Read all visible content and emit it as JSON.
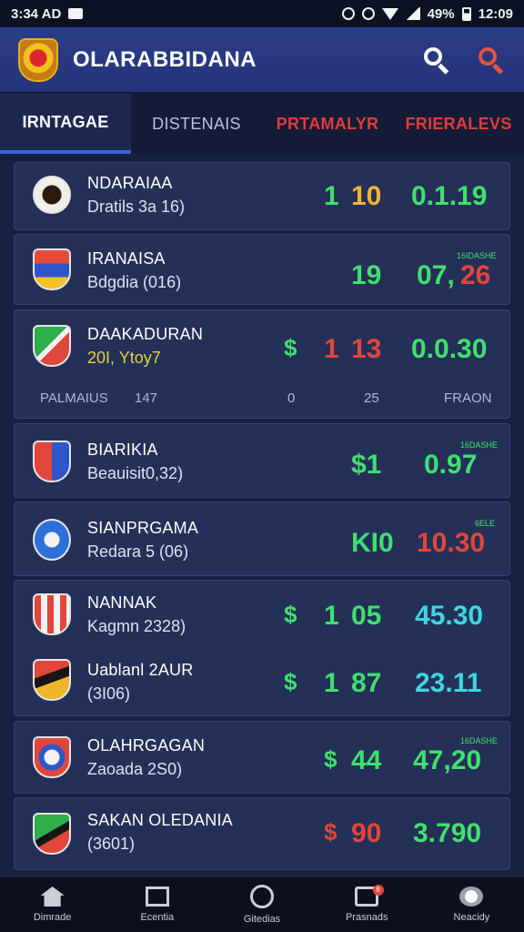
{
  "status_bar": {
    "time_left": "3:34 AD",
    "battery": "49%",
    "time_right": "12:09"
  },
  "header": {
    "title": "OLARABBIDANA"
  },
  "tabs": [
    {
      "label": "IRNTAGAE"
    },
    {
      "label": "DISTENAIS"
    },
    {
      "label": "PRTAMALYR"
    },
    {
      "label": "FRIERALEVS"
    }
  ],
  "rows": [
    {
      "name": "NDARAIAA",
      "sub": "Dratils 3a 16)",
      "v1": "1",
      "v2": "10",
      "v3": "0.1.19"
    },
    {
      "name": "IRANAISA",
      "sub": "Bdgdia (016)",
      "v2": "19",
      "v3": "07,",
      "v3b": "26",
      "tiny": "16IDASHE"
    },
    {
      "name": "DAAKADURAN",
      "sub": "20I, Ytoy7",
      "sym": "$",
      "v1": "1",
      "v2": "13",
      "v3": "0.0.30",
      "stats": {
        "label": "PALMAIUS",
        "a": "147",
        "b": "0",
        "c": "25",
        "d": "FRAON"
      }
    },
    {
      "name": "BIARIKIA",
      "sub": "Beauisit0,32)",
      "v2": "$1",
      "v3": "0.97",
      "tiny": "16DASHE"
    },
    {
      "name": "SIANPRGAMA",
      "sub": "Redara 5 (06)",
      "v2": "KI0",
      "v3": "10.30",
      "tiny": "6ELE"
    },
    {
      "name": "NANNAK",
      "sub": "Kagmn 2328)",
      "sym": "$",
      "v1": "1",
      "v2": "05",
      "v3": "45.30"
    },
    {
      "name": "Uablanl 2AUR",
      "sub": "(3I06)",
      "sym": "$",
      "v1": "1",
      "v2": "87",
      "v3": "23.11"
    },
    {
      "name": "OLAHRGAGAN",
      "sub": "Zaoada 2S0)",
      "sym": "$",
      "v2": "44",
      "v3": "47,20",
      "tiny": "16DASHE"
    },
    {
      "name": "SAKAN OLEDANIA",
      "sub": "(3601)",
      "sym": "$",
      "v2": "90",
      "v3": "3.790"
    }
  ],
  "bottom_nav": [
    {
      "label": "Dimrade"
    },
    {
      "label": "Ecentia"
    },
    {
      "label": "Gitedias"
    },
    {
      "label": "Prasnads",
      "badge": "8"
    },
    {
      "label": "Neacidy"
    }
  ],
  "colors": {
    "accent_blue": "#3f63d6",
    "positive": "#3fe06d",
    "negative": "#e2463a",
    "highlight": "#3dd6e0"
  }
}
